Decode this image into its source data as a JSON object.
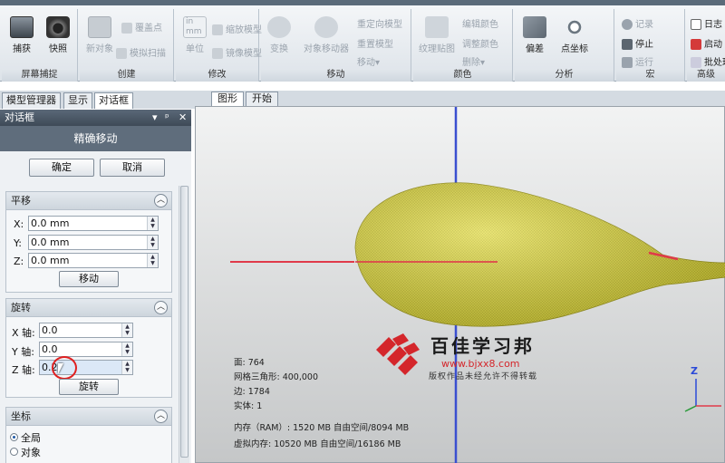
{
  "ribbon": {
    "groups": [
      {
        "label": "屏幕捕捉",
        "buttons": [
          "捕获",
          "快照"
        ]
      },
      {
        "label": "创建",
        "buttons": [
          "新对象",
          "覆盖点",
          "模拟扫描"
        ]
      },
      {
        "label": "修改",
        "buttons": [
          "单位",
          "缩放模型",
          "镜像模型"
        ]
      },
      {
        "label": "移动",
        "buttons": [
          "变换",
          "对象移动器",
          "重定向模型",
          "重置模型",
          "移动"
        ]
      },
      {
        "label": "颜色",
        "buttons": [
          "纹理贴图",
          "编辑颜色",
          "调整颜色",
          "删除"
        ]
      },
      {
        "label": "分析",
        "buttons": [
          "偏差",
          "点坐标"
        ]
      },
      {
        "label": "宏",
        "buttons": [
          "记录",
          "停止",
          "运行"
        ]
      },
      {
        "label": "高级",
        "buttons": [
          "日志",
          "启动",
          "批处理"
        ]
      }
    ],
    "unit_icon_text": "in",
    "unit_icon_text2": "mm"
  },
  "left_tabs": [
    "模型管理器",
    "显示",
    "对话框"
  ],
  "panel": {
    "bar_title": "对话框",
    "bar_controls": [
      "▾",
      "ᵖ",
      "✕"
    ],
    "title": "精确移动",
    "ok_label": "确定",
    "cancel_label": "取消",
    "translate": {
      "header": "平移",
      "x_label": "X:",
      "x_value": "0.0 mm",
      "y_label": "Y:",
      "y_value": "0.0 mm",
      "z_label": "Z:",
      "z_value": "0.0 mm",
      "button": "移动"
    },
    "rotate": {
      "header": "旋转",
      "x_label": "X 轴:",
      "x_value": "0.0",
      "y_label": "Y 轴:",
      "y_value": "0.0",
      "z_label": "Z 轴:",
      "z_value": "0.2",
      "button": "旋转"
    },
    "coords": {
      "header": "坐标",
      "options": [
        "全局",
        "对象"
      ],
      "selected": "全局"
    }
  },
  "viewport_tabs": [
    "图形",
    "开始"
  ],
  "stats": {
    "faces": "面: 764",
    "mesh": "网格三角形: 400,000",
    "edges": "边: 1784",
    "solids": "实体: 1",
    "ram": "内存（RAM）: 1520 MB 自由空间/8094 MB",
    "virtual": "虚拟内存: 10520 MB 自由空间/16186 MB"
  },
  "watermark": {
    "title": "百佳学习邦",
    "url": "www.bjxx8.com",
    "note": "版权作品未经允许不得转载"
  },
  "axis_label": "Z",
  "colors": {
    "model": "#d9d43a",
    "axis_blue": "#3a4fd0",
    "axis_red": "#e03a4a",
    "accent": "#d4262b"
  }
}
